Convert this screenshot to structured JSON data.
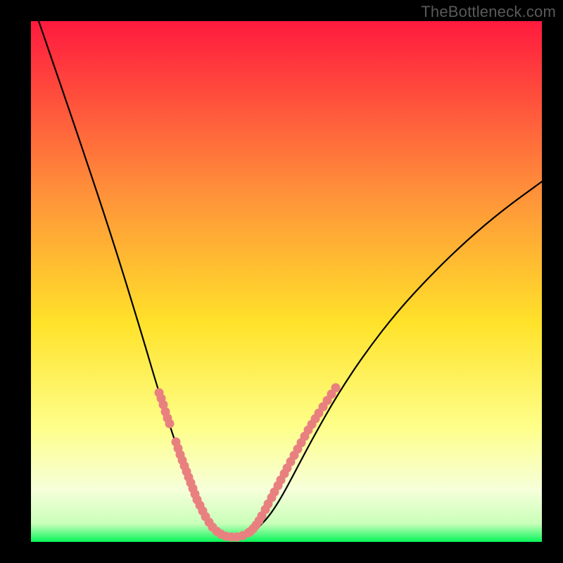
{
  "watermark": "TheBottleneck.com",
  "colors": {
    "frame": "#000000",
    "grad_top": "#ff1a3e",
    "grad_mid_upper": "#ff7a2a",
    "grad_mid": "#ffd923",
    "grad_lower": "#feff8a",
    "grad_pale": "#f6ffda",
    "grad_green": "#07f55a",
    "curve": "#000000",
    "dots": "#e98080"
  },
  "chart_data": {
    "type": "line",
    "title": "",
    "xlabel": "",
    "ylabel": "",
    "xlim": [
      44,
      770
    ],
    "ylim": [
      770,
      30
    ],
    "series": [
      {
        "name": "bottleneck-curve",
        "points": [
          [
            55,
            30
          ],
          [
            110,
            190
          ],
          [
            160,
            340
          ],
          [
            200,
            470
          ],
          [
            225,
            555
          ],
          [
            248,
            625
          ],
          [
            265,
            675
          ],
          [
            278,
            710
          ],
          [
            290,
            738
          ],
          [
            300,
            752
          ],
          [
            310,
            760
          ],
          [
            320,
            764
          ],
          [
            333,
            765
          ],
          [
            345,
            763
          ],
          [
            357,
            757
          ],
          [
            370,
            747
          ],
          [
            385,
            730
          ],
          [
            402,
            703
          ],
          [
            422,
            665
          ],
          [
            447,
            618
          ],
          [
            480,
            560
          ],
          [
            520,
            500
          ],
          [
            565,
            442
          ],
          [
            615,
            388
          ],
          [
            665,
            340
          ],
          [
            715,
            298
          ],
          [
            770,
            258
          ]
        ]
      }
    ],
    "dot_clusters": [
      {
        "name": "left-upper-segment",
        "points": [
          [
            226,
            558
          ],
          [
            229,
            566
          ],
          [
            232,
            575
          ],
          [
            235,
            585
          ],
          [
            238,
            594
          ],
          [
            241,
            602
          ]
        ]
      },
      {
        "name": "left-lower-segment",
        "points": [
          [
            250,
            628
          ],
          [
            253,
            637
          ],
          [
            256,
            646
          ],
          [
            259,
            654
          ],
          [
            262,
            662
          ],
          [
            265,
            670
          ],
          [
            268,
            678
          ],
          [
            271,
            686
          ],
          [
            274,
            694
          ],
          [
            277,
            702
          ],
          [
            280,
            710
          ],
          [
            284,
            718
          ],
          [
            288,
            726
          ],
          [
            292,
            734
          ],
          [
            297,
            742
          ],
          [
            302,
            749
          ],
          [
            308,
            755
          ],
          [
            314,
            759
          ],
          [
            321,
            762
          ],
          [
            329,
            763
          ],
          [
            337,
            763
          ],
          [
            345,
            761
          ],
          [
            353,
            757
          ]
        ]
      },
      {
        "name": "right-segment",
        "points": [
          [
            356,
            755
          ],
          [
            360,
            751
          ],
          [
            364,
            746
          ],
          [
            368,
            740
          ],
          [
            372,
            733
          ],
          [
            377,
            724
          ],
          [
            381,
            716
          ],
          [
            386,
            707
          ],
          [
            390,
            699
          ],
          [
            395,
            690
          ],
          [
            399,
            682
          ],
          [
            404,
            673
          ],
          [
            408,
            665
          ],
          [
            413,
            656
          ],
          [
            418,
            647
          ],
          [
            423,
            638
          ],
          [
            428,
            629
          ],
          [
            433,
            620
          ],
          [
            438,
            611
          ],
          [
            443,
            603
          ],
          [
            448,
            595
          ],
          [
            453,
            587
          ],
          [
            459,
            578
          ],
          [
            465,
            569
          ],
          [
            471,
            560
          ],
          [
            477,
            551
          ]
        ]
      }
    ],
    "gradient_stops": [
      {
        "offset": 0.0,
        "color": "#ff1a3e"
      },
      {
        "offset": 0.33,
        "color": "#ff913a"
      },
      {
        "offset": 0.58,
        "color": "#ffe22a"
      },
      {
        "offset": 0.78,
        "color": "#feff8a"
      },
      {
        "offset": 0.9,
        "color": "#f6ffda"
      },
      {
        "offset": 0.965,
        "color": "#c9ffb9"
      },
      {
        "offset": 1.0,
        "color": "#07f55a"
      }
    ]
  }
}
